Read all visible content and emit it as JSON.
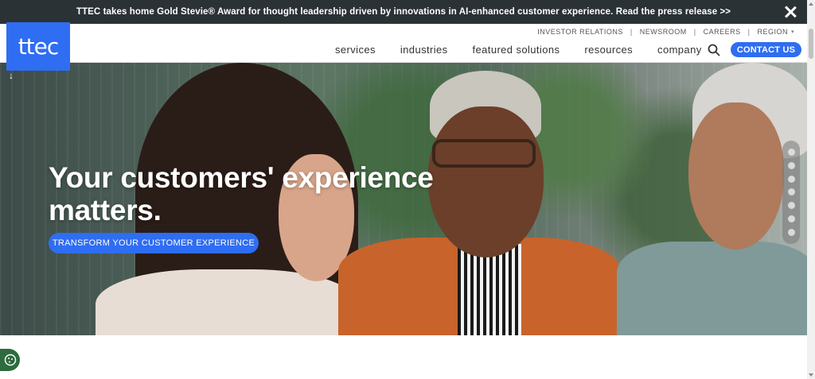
{
  "announcement": {
    "text": "TTEC takes home Gold Stevie® Award for thought leadership driven by innovations in AI-enhanced customer experience. Read the press release >>",
    "close_icon": "close-icon"
  },
  "logo": {
    "text": "ttec"
  },
  "utility_nav": {
    "items": [
      "INVESTOR RELATIONS",
      "NEWSROOM",
      "CAREERS",
      "REGION"
    ],
    "separator": "|",
    "region_caret": "▾"
  },
  "main_nav": {
    "items": [
      "services",
      "industries",
      "featured solutions",
      "resources",
      "company"
    ]
  },
  "search_icon": "search-icon",
  "contact_button": "CONTACT US",
  "hero": {
    "title_line1": "Your customers' experience",
    "title_line2": "matters.",
    "cta": "TRANSFORM YOUR CUSTOMER EXPERIENCE",
    "scroll_icon": "↓",
    "slide_count": 7
  },
  "colors": {
    "brand_blue": "#2f6df2",
    "announcement_bg": "#2b3236",
    "cookie_green": "#2e6b3f"
  }
}
